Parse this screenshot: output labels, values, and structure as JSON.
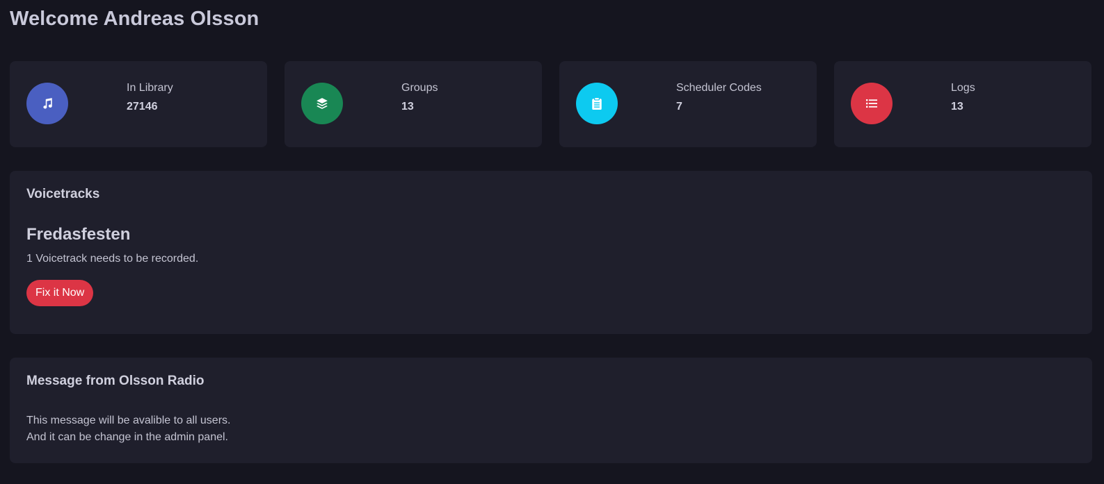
{
  "header": {
    "welcome": "Welcome Andreas Olsson"
  },
  "stats": [
    {
      "label": "In Library",
      "value": "27146",
      "icon": "music-icon",
      "color": "#4a5fc1"
    },
    {
      "label": "Groups",
      "value": "13",
      "icon": "layers-icon",
      "color": "#198754"
    },
    {
      "label": "Scheduler Codes",
      "value": "7",
      "icon": "clipboard-icon",
      "color": "#0dcaf0"
    },
    {
      "label": "Logs",
      "value": "13",
      "icon": "list-icon",
      "color": "#dc3545"
    }
  ],
  "voicetracks": {
    "title": "Voicetracks",
    "show_name": "Fredasfesten",
    "status": "1 Voicetrack needs to be recorded.",
    "button_label": "Fix it Now",
    "button_color": "#dc3545"
  },
  "message": {
    "title": "Message from Olsson Radio",
    "lines": [
      "This message will be avalible to all users.",
      "And it can be change in the admin panel."
    ]
  }
}
